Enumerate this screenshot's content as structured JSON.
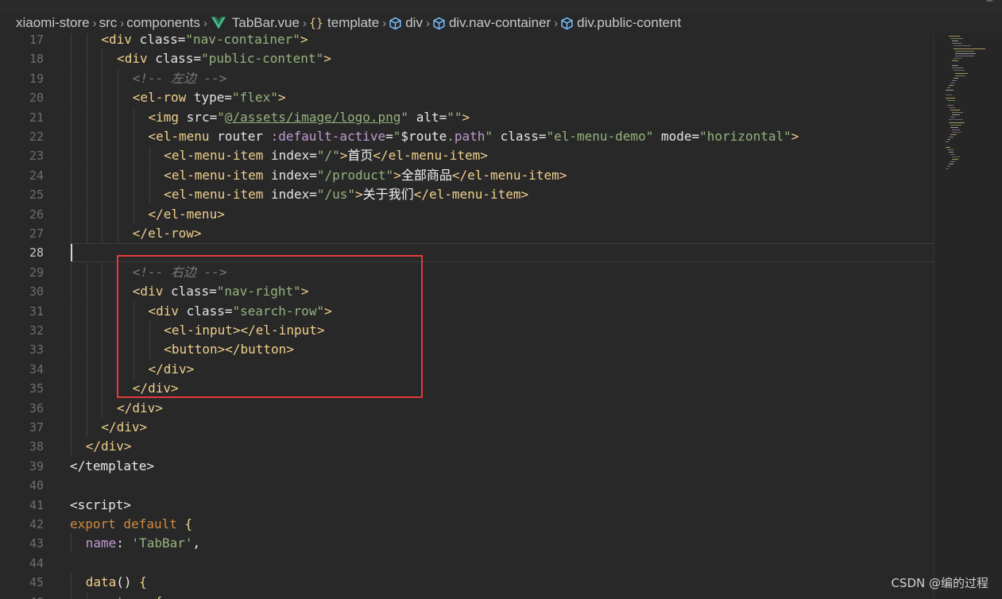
{
  "breadcrumb": {
    "items": [
      {
        "label": "xiaomi-store",
        "icon": ""
      },
      {
        "label": "src",
        "icon": ""
      },
      {
        "label": "components",
        "icon": ""
      },
      {
        "label": "TabBar.vue",
        "icon": "vue-icon"
      },
      {
        "label": "template",
        "icon": "braces-icon"
      },
      {
        "label": "div",
        "icon": "cube-icon"
      },
      {
        "label": "div.nav-container",
        "icon": "cube-icon"
      },
      {
        "label": "div.public-content",
        "icon": "cube-icon"
      }
    ],
    "braces_glyph": "{}"
  },
  "editor": {
    "active_line": 28,
    "lines": [
      {
        "n": "17",
        "indent": 2,
        "tokens": [
          [
            "tag",
            "<div "
          ],
          [
            "attr",
            "class"
          ],
          [
            "plain",
            "="
          ],
          [
            "str",
            "\"nav-container\""
          ],
          [
            "tag",
            ">"
          ]
        ]
      },
      {
        "n": "18",
        "indent": 3,
        "tokens": [
          [
            "tag",
            "<div "
          ],
          [
            "attr",
            "class"
          ],
          [
            "plain",
            "="
          ],
          [
            "str",
            "\"public-content\""
          ],
          [
            "tag",
            ">"
          ]
        ]
      },
      {
        "n": "19",
        "indent": 4,
        "tokens": [
          [
            "cmt",
            "<!-- 左边 -->"
          ]
        ]
      },
      {
        "n": "20",
        "indent": 4,
        "tokens": [
          [
            "tag",
            "<el-row "
          ],
          [
            "attr",
            "type"
          ],
          [
            "plain",
            "="
          ],
          [
            "str",
            "\"flex\""
          ],
          [
            "tag",
            ">"
          ]
        ]
      },
      {
        "n": "21",
        "indent": 5,
        "tokens": [
          [
            "tag",
            "<img "
          ],
          [
            "attr",
            "src"
          ],
          [
            "plain",
            "="
          ],
          [
            "str",
            "\""
          ],
          [
            "strU",
            "@/assets/image/logo.png"
          ],
          [
            "str",
            "\""
          ],
          [
            "attr",
            " alt"
          ],
          [
            "plain",
            "="
          ],
          [
            "str",
            "\"\""
          ],
          [
            "tag",
            ">"
          ]
        ]
      },
      {
        "n": "22",
        "indent": 5,
        "tokens": [
          [
            "tag",
            "<el-menu "
          ],
          [
            "attr",
            "router "
          ],
          [
            "dyn",
            ":default-active"
          ],
          [
            "plain",
            "="
          ],
          [
            "str",
            "\""
          ],
          [
            "plain",
            "$route"
          ],
          [
            "str",
            "."
          ],
          [
            "prop",
            "path"
          ],
          [
            "str",
            "\""
          ],
          [
            "attr",
            " class"
          ],
          [
            "plain",
            "="
          ],
          [
            "str",
            "\"el-menu-demo\""
          ],
          [
            "attr",
            " mode"
          ],
          [
            "plain",
            "="
          ],
          [
            "str",
            "\"horizontal\""
          ],
          [
            "tag",
            ">"
          ]
        ]
      },
      {
        "n": "23",
        "indent": 6,
        "tokens": [
          [
            "tag",
            "<el-menu-item "
          ],
          [
            "attr",
            "index"
          ],
          [
            "plain",
            "="
          ],
          [
            "str",
            "\"/\""
          ],
          [
            "tag",
            ">"
          ],
          [
            "txt",
            "首页"
          ],
          [
            "tag",
            "</el-menu-item>"
          ]
        ]
      },
      {
        "n": "24",
        "indent": 6,
        "tokens": [
          [
            "tag",
            "<el-menu-item "
          ],
          [
            "attr",
            "index"
          ],
          [
            "plain",
            "="
          ],
          [
            "str",
            "\"/product\""
          ],
          [
            "tag",
            ">"
          ],
          [
            "txt",
            "全部商品"
          ],
          [
            "tag",
            "</el-menu-item>"
          ]
        ]
      },
      {
        "n": "25",
        "indent": 6,
        "tokens": [
          [
            "tag",
            "<el-menu-item "
          ],
          [
            "attr",
            "index"
          ],
          [
            "plain",
            "="
          ],
          [
            "str",
            "\"/us\""
          ],
          [
            "tag",
            ">"
          ],
          [
            "txt",
            "关于我们"
          ],
          [
            "tag",
            "</el-menu-item>"
          ]
        ]
      },
      {
        "n": "26",
        "indent": 5,
        "tokens": [
          [
            "tag",
            "</el-menu>"
          ]
        ]
      },
      {
        "n": "27",
        "indent": 4,
        "tokens": [
          [
            "tag",
            "</el-row>"
          ]
        ]
      },
      {
        "n": "28",
        "indent": 0,
        "tokens": []
      },
      {
        "n": "29",
        "indent": 4,
        "tokens": [
          [
            "cmt",
            "<!-- 右边 -->"
          ]
        ]
      },
      {
        "n": "30",
        "indent": 4,
        "tokens": [
          [
            "tag",
            "<div "
          ],
          [
            "attr",
            "class"
          ],
          [
            "plain",
            "="
          ],
          [
            "str",
            "\"nav-right\""
          ],
          [
            "tag",
            ">"
          ]
        ]
      },
      {
        "n": "31",
        "indent": 5,
        "tokens": [
          [
            "tag",
            "<div "
          ],
          [
            "attr",
            "class"
          ],
          [
            "plain",
            "="
          ],
          [
            "str",
            "\"search-row\""
          ],
          [
            "tag",
            ">"
          ]
        ]
      },
      {
        "n": "32",
        "indent": 6,
        "tokens": [
          [
            "tag",
            "<el-input></el-input>"
          ]
        ]
      },
      {
        "n": "33",
        "indent": 6,
        "tokens": [
          [
            "tag",
            "<button></button>"
          ]
        ]
      },
      {
        "n": "34",
        "indent": 5,
        "tokens": [
          [
            "tag",
            "</div>"
          ]
        ]
      },
      {
        "n": "35",
        "indent": 4,
        "tokens": [
          [
            "tag",
            "</div>"
          ]
        ]
      },
      {
        "n": "36",
        "indent": 3,
        "tokens": [
          [
            "tag",
            "</div>"
          ]
        ]
      },
      {
        "n": "37",
        "indent": 2,
        "tokens": [
          [
            "tag",
            "</div>"
          ]
        ]
      },
      {
        "n": "38",
        "indent": 1,
        "tokens": [
          [
            "tag",
            "</div>"
          ]
        ]
      },
      {
        "n": "39",
        "indent": 0,
        "tokens": [
          [
            "plain",
            "</template>"
          ]
        ]
      },
      {
        "n": "40",
        "indent": 0,
        "tokens": []
      },
      {
        "n": "41",
        "indent": 0,
        "tokens": [
          [
            "plain",
            "<script>"
          ]
        ]
      },
      {
        "n": "42",
        "indent": 0,
        "tokens": [
          [
            "kw",
            "export default "
          ],
          [
            "tag",
            "{"
          ]
        ]
      },
      {
        "n": "43",
        "indent": 1,
        "tokens": [
          [
            "prop",
            "name"
          ],
          [
            "plain",
            ": "
          ],
          [
            "str",
            "'TabBar'"
          ],
          [
            "plain",
            ","
          ]
        ]
      },
      {
        "n": "44",
        "indent": 0,
        "tokens": []
      },
      {
        "n": "45",
        "indent": 1,
        "tokens": [
          [
            "fn",
            "data"
          ],
          [
            "plain",
            "() "
          ],
          [
            "tag",
            "{"
          ]
        ]
      },
      {
        "n": "46",
        "indent": 2,
        "tokens": [
          [
            "kw",
            "return "
          ],
          [
            "tag",
            "{"
          ]
        ]
      }
    ]
  },
  "colors": {
    "background": "#282828",
    "tag": "#f0cf8c",
    "string": "#96b37e",
    "comment": "#7a7a7a",
    "keyword": "#ce8b43",
    "property": "#c19ad3",
    "highlight_box": "#e4393c"
  },
  "watermark": "CSDN @编的过程"
}
